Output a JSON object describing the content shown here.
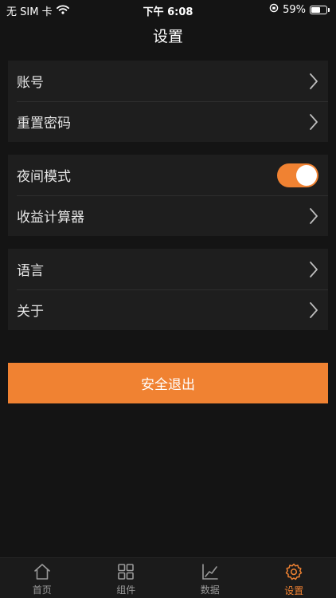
{
  "status_bar": {
    "carrier": "无 SIM 卡",
    "time": "下午 6:08",
    "battery": "59%",
    "battery_level": 0.59
  },
  "header": {
    "title": "设置"
  },
  "groups": [
    {
      "items": [
        {
          "label": "账号"
        },
        {
          "label": "重置密码"
        }
      ]
    },
    {
      "items": [
        {
          "label": "夜间模式",
          "toggle_on": true
        },
        {
          "label": "收益计算器"
        }
      ]
    },
    {
      "items": [
        {
          "label": "语言"
        },
        {
          "label": "关于"
        }
      ]
    }
  ],
  "logout_label": "安全退出",
  "tabbar": {
    "items": [
      {
        "label": "首页",
        "icon": "home-icon",
        "active": false
      },
      {
        "label": "组件",
        "icon": "grid-icon",
        "active": false
      },
      {
        "label": "数据",
        "icon": "chart-icon",
        "active": false
      },
      {
        "label": "设置",
        "icon": "gear-icon",
        "active": true
      }
    ]
  },
  "colors": {
    "accent": "#f08232",
    "background": "#141414",
    "card": "#1e1e1e",
    "tab_inactive": "#9a9a9a"
  }
}
